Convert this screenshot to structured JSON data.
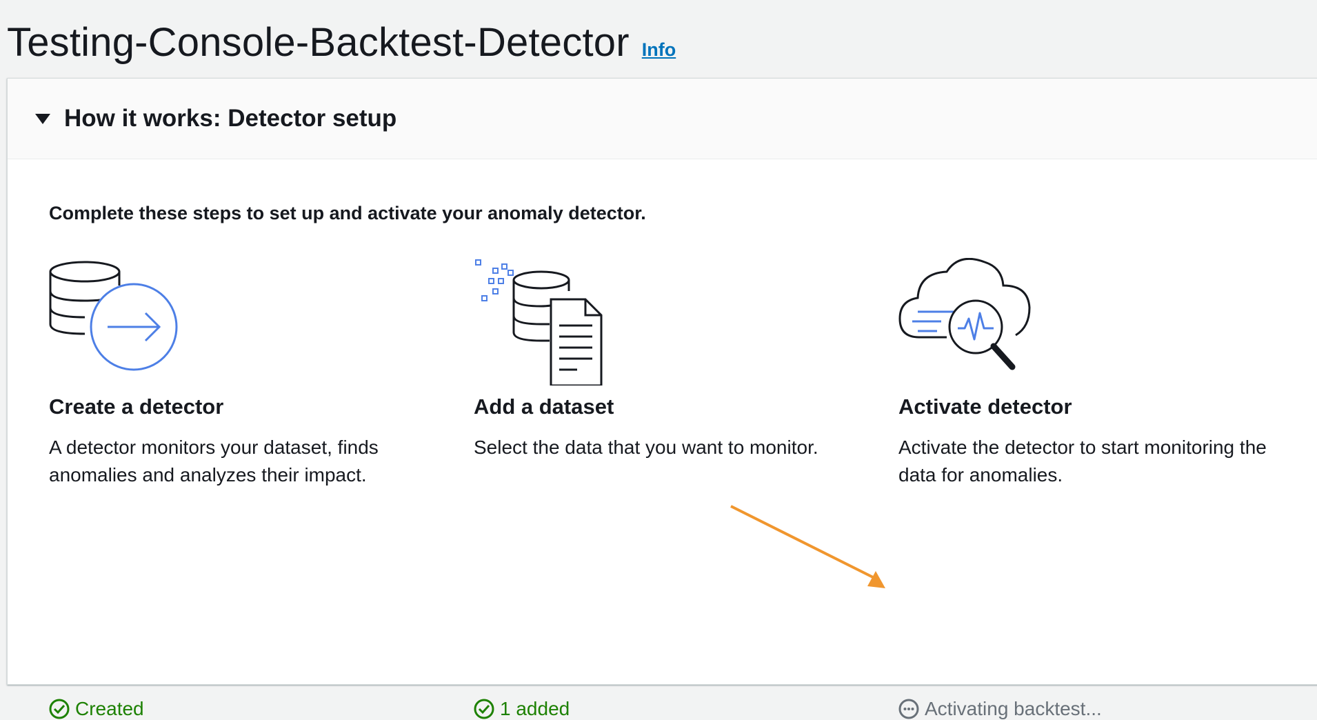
{
  "page": {
    "title": "Testing-Console-Backtest-Detector",
    "info_label": "Info"
  },
  "panel": {
    "title": "How it works: Detector setup",
    "intro": "Complete these steps to set up and activate your anomaly detector."
  },
  "steps": [
    {
      "icon": "database-arrow-icon",
      "title": "Create a detector",
      "description": "A detector monitors your dataset, finds anomalies and analyzes their impact.",
      "status": "Created",
      "status_type": "success"
    },
    {
      "icon": "database-document-icon",
      "title": "Add a dataset",
      "description": "Select the data that you want to monitor.",
      "status": "1 added",
      "status_type": "success"
    },
    {
      "icon": "cloud-magnifier-icon",
      "title": "Activate detector",
      "description": "Activate the detector to start monitoring the data for anomalies.",
      "status": "Activating backtest...",
      "status_type": "in-progress"
    }
  ],
  "colors": {
    "success": "#1d8102",
    "pending": "#687078",
    "link": "#0073bb",
    "icon_accent": "#4d7fe6",
    "annotation_arrow": "#f0962e"
  }
}
